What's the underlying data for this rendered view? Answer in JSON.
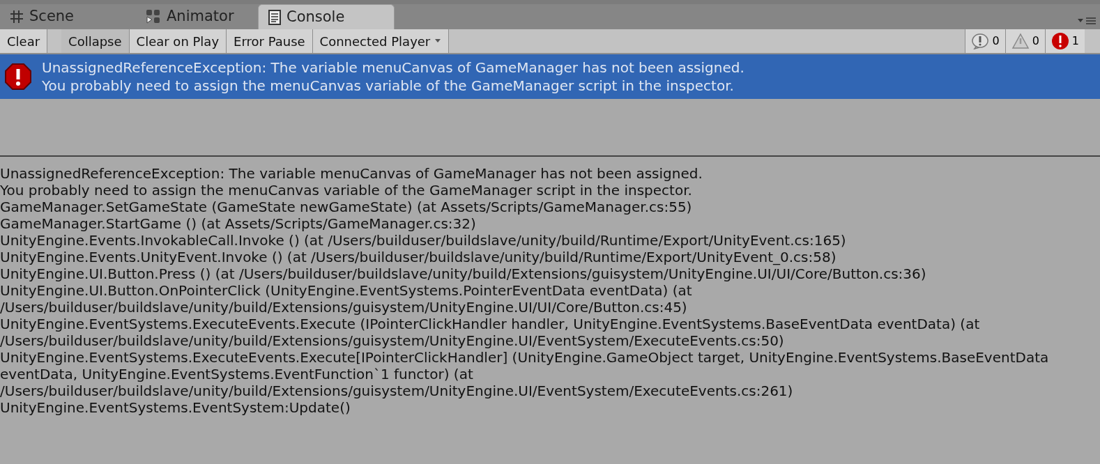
{
  "tabs": [
    {
      "label": "Scene",
      "selected": false
    },
    {
      "label": "Animator",
      "selected": false
    },
    {
      "label": "Console",
      "selected": true
    }
  ],
  "toolbar": {
    "buttons": [
      {
        "label": "Clear",
        "kind": "button",
        "on": false
      },
      {
        "label": "Collapse",
        "kind": "toggle",
        "on": true
      },
      {
        "label": "Clear on Play",
        "kind": "toggle",
        "on": false
      },
      {
        "label": "Error Pause",
        "kind": "toggle",
        "on": false
      },
      {
        "label": "Connected Player",
        "kind": "dropdown",
        "on": false
      }
    ],
    "counters": [
      {
        "kind": "info",
        "count": "0",
        "on": true
      },
      {
        "kind": "warning",
        "count": "0",
        "on": true
      },
      {
        "kind": "error",
        "count": "1",
        "on": true
      }
    ]
  },
  "log_entries": [
    {
      "kind": "error",
      "selected": true,
      "lines": [
        "UnassignedReferenceException: The variable menuCanvas of GameManager has not been assigned.",
        "You probably need to assign the menuCanvas variable of the GameManager script in the inspector."
      ]
    }
  ],
  "detail_lines": [
    "UnassignedReferenceException: The variable menuCanvas of GameManager has not been assigned.",
    "You probably need to assign the menuCanvas variable of the GameManager script in the inspector.",
    "GameManager.SetGameState (GameState newGameState) (at Assets/Scripts/GameManager.cs:55)",
    "GameManager.StartGame () (at Assets/Scripts/GameManager.cs:32)",
    "UnityEngine.Events.InvokableCall.Invoke () (at /Users/builduser/buildslave/unity/build/Runtime/Export/UnityEvent.cs:165)",
    "UnityEngine.Events.UnityEvent.Invoke () (at /Users/builduser/buildslave/unity/build/Runtime/Export/UnityEvent_0.cs:58)",
    "UnityEngine.UI.Button.Press () (at /Users/builduser/buildslave/unity/build/Extensions/guisystem/UnityEngine.UI/UI/Core/Button.cs:36)",
    "UnityEngine.UI.Button.OnPointerClick (UnityEngine.EventSystems.PointerEventData eventData) (at",
    "/Users/builduser/buildslave/unity/build/Extensions/guisystem/UnityEngine.UI/UI/Core/Button.cs:45)",
    "UnityEngine.EventSystems.ExecuteEvents.Execute (IPointerClickHandler handler, UnityEngine.EventSystems.BaseEventData eventData) (at",
    "/Users/builduser/buildslave/unity/build/Extensions/guisystem/UnityEngine.UI/EventSystem/ExecuteEvents.cs:50)",
    "UnityEngine.EventSystems.ExecuteEvents.Execute[IPointerClickHandler] (UnityEngine.GameObject target, UnityEngine.EventSystems.BaseEventData",
    "eventData, UnityEngine.EventSystems.EventFunction`1 functor) (at",
    "/Users/builduser/buildslave/unity/build/Extensions/guisystem/UnityEngine.UI/EventSystem/ExecuteEvents.cs:261)",
    "UnityEngine.EventSystems.EventSystem:Update()"
  ]
}
